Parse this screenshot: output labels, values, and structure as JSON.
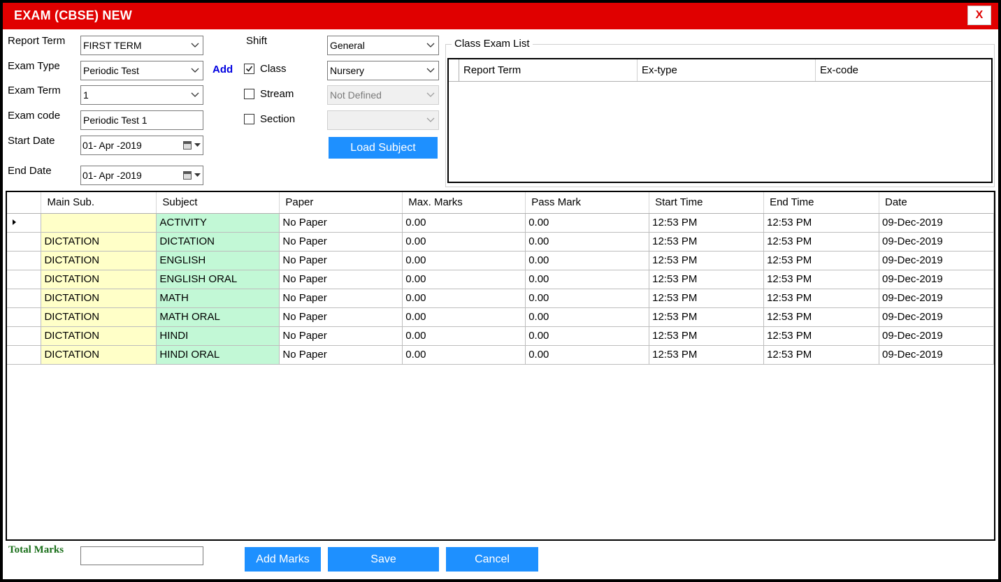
{
  "window": {
    "title": "EXAM (CBSE) NEW",
    "close_label": "X"
  },
  "form": {
    "report_term": {
      "label": "Report Term",
      "value": "FIRST TERM"
    },
    "exam_type": {
      "label": "Exam Type",
      "value": "Periodic Test",
      "add_label": "Add"
    },
    "exam_term": {
      "label": "Exam Term",
      "value": "1"
    },
    "exam_code": {
      "label": "Exam code",
      "value": "Periodic Test 1"
    },
    "start_date": {
      "label": "Start Date",
      "value": "01- Apr -2019"
    },
    "end_date": {
      "label": "End Date",
      "value": "01- Apr -2019"
    },
    "shift": {
      "label": "Shift",
      "value": "General"
    },
    "class": {
      "label": "Class",
      "checked": true,
      "value": "Nursery"
    },
    "stream": {
      "label": "Stream",
      "checked": false,
      "value": "Not Defined"
    },
    "section": {
      "label": "Section",
      "checked": false,
      "value": ""
    },
    "load_subject_label": "Load Subject"
  },
  "class_exam_list": {
    "title": "Class Exam List",
    "columns": [
      "Report Term",
      "Ex-type",
      "Ex-code"
    ]
  },
  "subjects_table": {
    "columns": [
      "Main Sub.",
      "Subject",
      "Paper",
      "Max. Marks",
      "Pass Mark",
      "Start Time",
      "End Time",
      "Date"
    ],
    "rows": [
      {
        "main": "",
        "subject": "ACTIVITY",
        "paper": "No Paper",
        "max": "0.00",
        "pass": "0.00",
        "start": "12:53 PM",
        "end": "12:53 PM",
        "date": "09-Dec-2019"
      },
      {
        "main": "DICTATION",
        "subject": "DICTATION",
        "paper": "No Paper",
        "max": "0.00",
        "pass": "0.00",
        "start": "12:53 PM",
        "end": "12:53 PM",
        "date": "09-Dec-2019"
      },
      {
        "main": "DICTATION",
        "subject": "ENGLISH",
        "paper": "No Paper",
        "max": "0.00",
        "pass": "0.00",
        "start": "12:53 PM",
        "end": "12:53 PM",
        "date": "09-Dec-2019"
      },
      {
        "main": "DICTATION",
        "subject": "ENGLISH ORAL",
        "paper": "No Paper",
        "max": "0.00",
        "pass": "0.00",
        "start": "12:53 PM",
        "end": "12:53 PM",
        "date": "09-Dec-2019"
      },
      {
        "main": "DICTATION",
        "subject": "MATH",
        "paper": "No Paper",
        "max": "0.00",
        "pass": "0.00",
        "start": "12:53 PM",
        "end": "12:53 PM",
        "date": "09-Dec-2019"
      },
      {
        "main": "DICTATION",
        "subject": "MATH ORAL",
        "paper": "No Paper",
        "max": "0.00",
        "pass": "0.00",
        "start": "12:53 PM",
        "end": "12:53 PM",
        "date": "09-Dec-2019"
      },
      {
        "main": "DICTATION",
        "subject": "HINDI",
        "paper": "No Paper",
        "max": "0.00",
        "pass": "0.00",
        "start": "12:53 PM",
        "end": "12:53 PM",
        "date": "09-Dec-2019"
      },
      {
        "main": "DICTATION",
        "subject": "HINDI ORAL",
        "paper": "No Paper",
        "max": "0.00",
        "pass": "0.00",
        "start": "12:53 PM",
        "end": "12:53 PM",
        "date": "09-Dec-2019"
      }
    ]
  },
  "footer": {
    "total_marks_label": "Total Marks",
    "total_marks_value": "",
    "add_marks_label": "Add Marks",
    "save_label": "Save",
    "cancel_label": "Cancel"
  },
  "colors": {
    "title_bar": "#e00000",
    "button": "#1e90ff",
    "main_sub_cell": "#ffffc8",
    "subject_cell": "#c2f8d6",
    "add_link": "#0000e0",
    "total_marks_label": "#1a6f1a"
  },
  "icons": {
    "close": "close-icon",
    "dropdown": "chevron-down-icon",
    "calendar": "calendar-icon",
    "checkbox_checked": "checkmark-icon",
    "row_indicator": "current-row-arrow-icon"
  }
}
